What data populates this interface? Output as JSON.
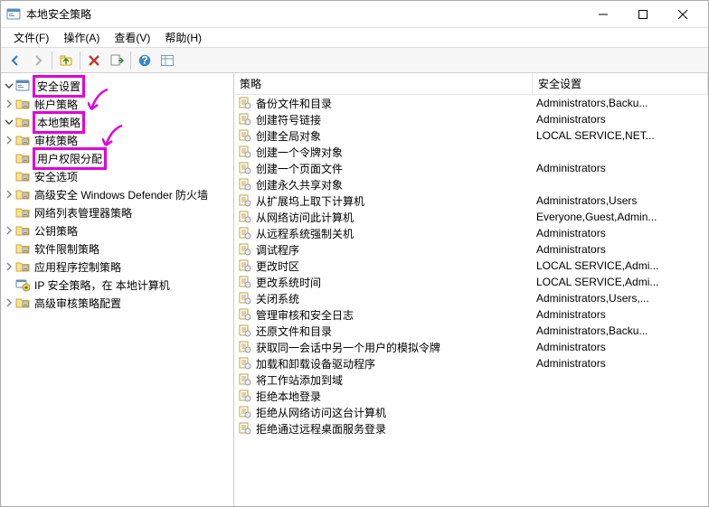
{
  "window": {
    "title": "本地安全策略"
  },
  "menu": {
    "file": "文件(F)",
    "action": "操作(A)",
    "view": "查看(V)",
    "help": "帮助(H)"
  },
  "toolbar_icons": {
    "back": "back-icon",
    "forward": "forward-icon",
    "up": "up-icon",
    "delete": "delete-icon",
    "export": "export-icon",
    "help": "help-icon",
    "details": "details-icon"
  },
  "tree": {
    "root": {
      "label": "安全设置",
      "expanded": true
    },
    "items": [
      {
        "label": "帐户策略",
        "expandable": true,
        "indent": 1
      },
      {
        "label": "本地策略",
        "expandable": true,
        "expanded": true,
        "indent": 1,
        "highlight": true,
        "children": [
          {
            "label": "审核策略",
            "indent": 2,
            "expandable": true
          },
          {
            "label": "用户权限分配",
            "indent": 2,
            "highlight": true
          },
          {
            "label": "安全选项",
            "indent": 2
          }
        ]
      },
      {
        "label": "高级安全 Windows Defender 防火墙",
        "expandable": true,
        "indent": 1
      },
      {
        "label": "网络列表管理器策略",
        "indent": 1
      },
      {
        "label": "公钥策略",
        "expandable": true,
        "indent": 1
      },
      {
        "label": "软件限制策略",
        "indent": 1
      },
      {
        "label": "应用程序控制策略",
        "expandable": true,
        "indent": 1
      },
      {
        "label": "IP 安全策略，在 本地计算机",
        "indent": 1,
        "icon": "ipsec"
      },
      {
        "label": "高级审核策略配置",
        "expandable": true,
        "indent": 1
      }
    ]
  },
  "list": {
    "headers": {
      "name": "策略",
      "setting": "安全设置"
    },
    "rows": [
      {
        "name": "备份文件和目录",
        "setting": "Administrators,Backu..."
      },
      {
        "name": "创建符号链接",
        "setting": "Administrators"
      },
      {
        "name": "创建全局对象",
        "setting": "LOCAL SERVICE,NET..."
      },
      {
        "name": "创建一个令牌对象",
        "setting": ""
      },
      {
        "name": "创建一个页面文件",
        "setting": "Administrators"
      },
      {
        "name": "创建永久共享对象",
        "setting": ""
      },
      {
        "name": "从扩展坞上取下计算机",
        "setting": "Administrators,Users"
      },
      {
        "name": "从网络访问此计算机",
        "setting": "Everyone,Guest,Admin..."
      },
      {
        "name": "从远程系统强制关机",
        "setting": "Administrators"
      },
      {
        "name": "调试程序",
        "setting": "Administrators"
      },
      {
        "name": "更改时区",
        "setting": "LOCAL SERVICE,Admi..."
      },
      {
        "name": "更改系统时间",
        "setting": "LOCAL SERVICE,Admi..."
      },
      {
        "name": "关闭系统",
        "setting": "Administrators,Users,..."
      },
      {
        "name": "管理审核和安全日志",
        "setting": "Administrators"
      },
      {
        "name": "还原文件和目录",
        "setting": "Administrators,Backu..."
      },
      {
        "name": "获取同一会话中另一个用户的模拟令牌",
        "setting": "Administrators"
      },
      {
        "name": "加载和卸载设备驱动程序",
        "setting": "Administrators"
      },
      {
        "name": "将工作站添加到域",
        "setting": ""
      },
      {
        "name": "拒绝本地登录",
        "setting": ""
      },
      {
        "name": "拒绝从网络访问这台计算机",
        "setting": ""
      },
      {
        "name": "拒绝通过远程桌面服务登录",
        "setting": ""
      }
    ]
  },
  "colors": {
    "highlight": "#e000d7"
  }
}
